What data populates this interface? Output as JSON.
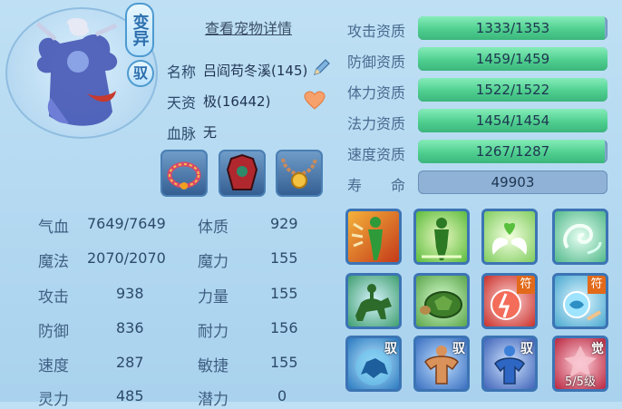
{
  "header": {
    "variant_badge": "变异",
    "tamed_badge": "驭",
    "details_link": "查看宠物详情"
  },
  "info": {
    "name_label": "名称",
    "name_value": "吕阎苟冬溪(145)",
    "talent_label": "天资",
    "talent_value": "极(16442)",
    "bloodline_label": "血脉",
    "bloodline_value": "无"
  },
  "equipment": [
    {
      "name": "bracelet"
    },
    {
      "name": "armor"
    },
    {
      "name": "necklace"
    }
  ],
  "stats": [
    {
      "label": "气血",
      "value": "7649/7649",
      "label2": "体质",
      "value2": "929"
    },
    {
      "label": "魔法",
      "value": "2070/2070",
      "label2": "魔力",
      "value2": "155"
    },
    {
      "label": "攻击",
      "value": "938",
      "label2": "力量",
      "value2": "155"
    },
    {
      "label": "防御",
      "value": "836",
      "label2": "耐力",
      "value2": "156"
    },
    {
      "label": "速度",
      "value": "287",
      "label2": "敏捷",
      "value2": "155"
    },
    {
      "label": "灵力",
      "value": "485",
      "label2": "潜力",
      "value2": "0"
    }
  ],
  "attributes": [
    {
      "label": "攻击资质",
      "text": "1333/1353",
      "fill": 0.985
    },
    {
      "label": "防御资质",
      "text": "1459/1459",
      "fill": 1.0
    },
    {
      "label": "体力资质",
      "text": "1522/1522",
      "fill": 1.0
    },
    {
      "label": "法力资质",
      "text": "1454/1454",
      "fill": 1.0
    },
    {
      "label": "速度资质",
      "text": "1267/1287",
      "fill": 0.984
    }
  ],
  "lifespan": {
    "label": "寿　　命",
    "value": "49903"
  },
  "skills": {
    "row3_tags": [
      "驭",
      "驭",
      "驭",
      "觉"
    ],
    "row2_corner": "符",
    "level_badge": "5/5级"
  },
  "colors": {
    "bar_fill": "#4fcf90",
    "bar_track": "#7fa6cc",
    "background": "#b4d8f0",
    "skill_border": "#3c74b4"
  }
}
